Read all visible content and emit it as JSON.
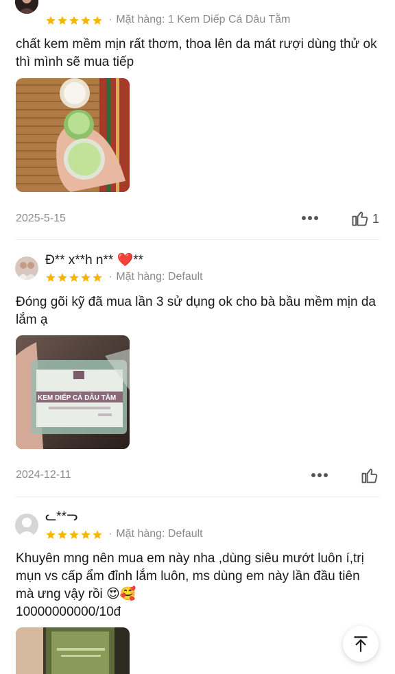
{
  "reviews": [
    {
      "username": "",
      "rating": 5,
      "variant_prefix": "·",
      "variant": "Mặt hàng: 1 Kem Diếp Cá Dâu Tằm",
      "text": "chất kem mềm mịn rất thơm, thoa lên da mát rượi dùng thử ok thì mình sẽ mua tiếp",
      "date": "2025-5-15",
      "likes": "1"
    },
    {
      "username": "Đ** x**h n** ❤️**",
      "rating": 5,
      "variant_prefix": "·",
      "variant": "Mặt hàng: Default",
      "text": "Đóng gõi kỹ đã mua lần 3 sử dụng ok cho bà bầu mềm mịn da lắm ạ",
      "date": "2024-12-11",
      "likes": "",
      "photo_label": "KEM DIẾP CÁ DÂU TẰM"
    },
    {
      "username": "ᓚ**ᓓ",
      "rating": 5,
      "variant_prefix": "·",
      "variant": "Mặt hàng: Default",
      "text": "Khuyên mng nên mua em này nha ,dùng siêu mướt luôn í,trị mụn vs cấp ẩm đỉnh lắm luôn, ms dùng em này lần đầu tiên mà ưng vậy rồi 😍🥰\n10000000000/10đ"
    }
  ],
  "icons": {
    "star": "star-icon",
    "more": "more-icon",
    "like": "thumbs-up-icon",
    "scroll_top": "arrow-up-to-top-icon"
  },
  "colors": {
    "star": "#f7b500",
    "muted": "#8c8c8c",
    "divider": "#ececec"
  }
}
